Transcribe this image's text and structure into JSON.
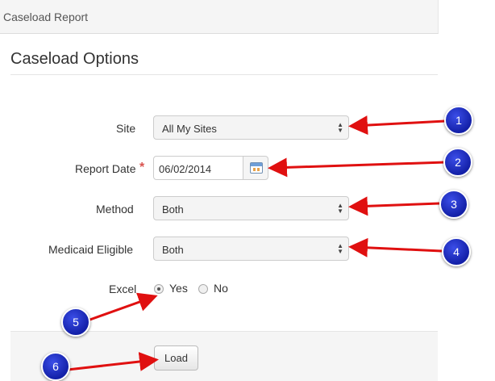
{
  "header": {
    "title": "Caseload Report"
  },
  "page": {
    "title": "Caseload Options"
  },
  "form": {
    "site": {
      "label": "Site",
      "value": "All My Sites"
    },
    "report_date": {
      "label": "Report Date",
      "value": "06/02/2014",
      "required_mark": "*"
    },
    "method": {
      "label": "Method",
      "value": "Both"
    },
    "medicaid": {
      "label": "Medicaid Eligible",
      "value": "Both"
    },
    "excel": {
      "label": "Excel",
      "options": [
        "Yes",
        "No"
      ],
      "selected": "Yes"
    }
  },
  "actions": {
    "load_label": "Load"
  },
  "callouts": [
    "1",
    "2",
    "3",
    "4",
    "5",
    "6"
  ],
  "colors": {
    "callout": "#1a2bc9",
    "arrow": "#e01010",
    "required": "#d9534f"
  },
  "icons": {
    "calendar": "calendar-icon",
    "select_caret": "up-down-caret-icon"
  }
}
